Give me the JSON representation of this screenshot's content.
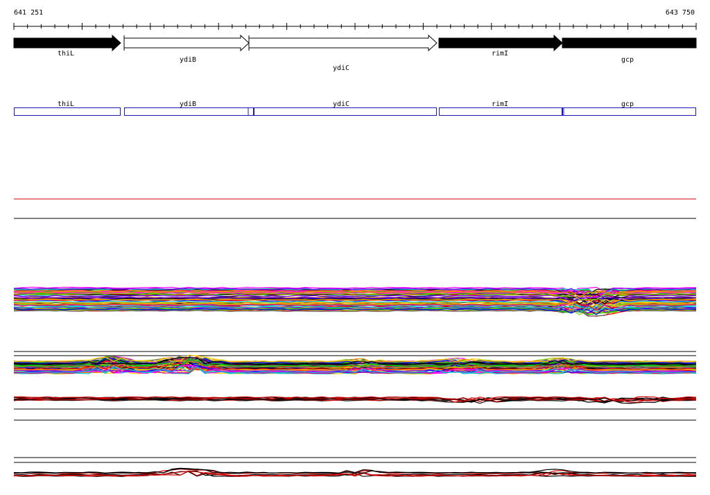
{
  "region": {
    "start_label": "641 251",
    "end_label": "643 750"
  },
  "genes": [
    {
      "name": "thiL",
      "strand": "+",
      "fill": "black"
    },
    {
      "name": "ydiB",
      "strand": "+",
      "fill": "white"
    },
    {
      "name": "ydiC",
      "strand": "+",
      "fill": "white"
    },
    {
      "name": "rimI",
      "strand": "+",
      "fill": "black"
    },
    {
      "name": "gcp",
      "strand": "+",
      "fill": "black"
    }
  ],
  "feature_track": [
    {
      "name": "thiL"
    },
    {
      "name": "ydiB"
    },
    {
      "name": "ydiC"
    },
    {
      "name": "rimI"
    },
    {
      "name": "gcp"
    }
  ],
  "colors": {
    "feature_box": "#1a1ab0",
    "guide_red": "#cc0000",
    "guide_black": "#000000",
    "profile_palette": [
      "#ff0000",
      "#00cc00",
      "#0000ff",
      "#ff00ff",
      "#00cccc",
      "#ffcc00",
      "#000000",
      "#ff8800",
      "#8800ff",
      "#88cc00",
      "#cc0088",
      "#666666"
    ]
  }
}
